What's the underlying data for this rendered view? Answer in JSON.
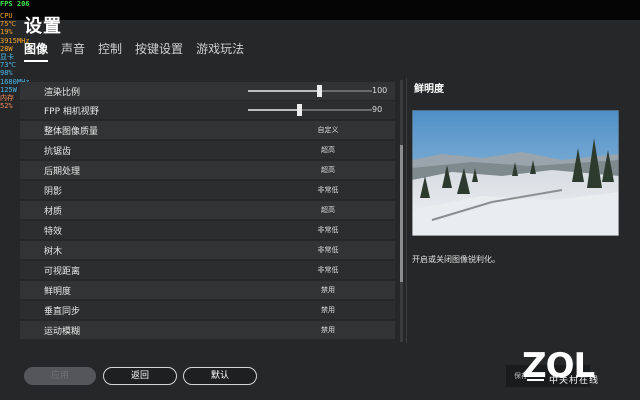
{
  "overlay": {
    "fps_label": "FPS",
    "fps_value": "206",
    "cpu": [
      "CPU",
      "75℃",
      "19%",
      "3915MHz",
      "28W"
    ],
    "gpu": [
      "显卡",
      "73℃",
      "98%",
      "1680MHz",
      "125W"
    ],
    "mem": [
      "内存",
      "52%"
    ]
  },
  "header": {
    "title": "设置",
    "tabs": [
      "图像",
      "声音",
      "控制",
      "按键设置",
      "游戏玩法"
    ]
  },
  "settings": {
    "rows": [
      {
        "label": "渲染比例",
        "type": "slider",
        "value": "100",
        "fraction": 0.57
      },
      {
        "label": "FPP 相机视野",
        "type": "slider",
        "value": "90",
        "fraction": 0.41
      },
      {
        "label": "整体图像质量",
        "type": "value",
        "value": "自定义"
      },
      {
        "label": "抗锯齿",
        "type": "value",
        "value": "超高"
      },
      {
        "label": "后期处理",
        "type": "value",
        "value": "超高"
      },
      {
        "label": "阴影",
        "type": "value",
        "value": "非常低"
      },
      {
        "label": "材质",
        "type": "value",
        "value": "超高"
      },
      {
        "label": "特效",
        "type": "value",
        "value": "非常低"
      },
      {
        "label": "树木",
        "type": "value",
        "value": "非常低"
      },
      {
        "label": "可视距离",
        "type": "value",
        "value": "非常低"
      },
      {
        "label": "鲜明度",
        "type": "value",
        "value": "禁用"
      },
      {
        "label": "垂直同步",
        "type": "value",
        "value": "禁用"
      },
      {
        "label": "运动模糊",
        "type": "value",
        "value": "禁用"
      }
    ],
    "scroll_fraction": 0.52
  },
  "detail": {
    "title": "鲜明度",
    "description": "开启或关闭图像锐利化。"
  },
  "footer": {
    "apply": "应用",
    "back": "返回",
    "reset": "默认",
    "save_glyph": "保存",
    "watermark": "ZOL",
    "watermark_sub": "中关村在线"
  },
  "colors": {
    "fps": "#3ee34c",
    "cpu": "#f2a42a",
    "gpu": "#48b7ea",
    "mem": "#f08a5a"
  }
}
